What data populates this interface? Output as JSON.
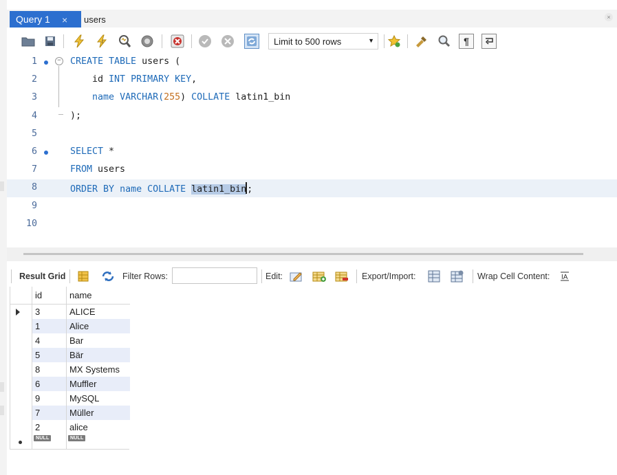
{
  "tabs": [
    {
      "label": "Query 1",
      "close": "×",
      "active": true
    },
    {
      "label": "users",
      "active": false
    }
  ],
  "toolbar": {
    "limit_label": "Limit to 500 rows",
    "icons": [
      "open-folder-icon",
      "save-icon",
      "execute-icon",
      "execute-current-icon",
      "explain-icon",
      "stop-icon",
      "toggle-error-icon",
      "commit-icon",
      "rollback-icon",
      "autocommit-icon",
      "bookmark-star-icon",
      "beautify-icon",
      "find-icon",
      "invisible-chars-icon",
      "wrap-icon"
    ]
  },
  "editor": {
    "lines": [
      {
        "n": "1",
        "tokens": [
          {
            "t": "CREATE TABLE ",
            "c": "kw"
          },
          {
            "t": "users (",
            "c": "id"
          }
        ]
      },
      {
        "n": "2",
        "tokens": [
          {
            "t": "    id ",
            "c": "id"
          },
          {
            "t": "INT PRIMARY KEY",
            "c": "kw"
          },
          {
            "t": ",",
            "c": "id"
          }
        ]
      },
      {
        "n": "3",
        "tokens": [
          {
            "t": "    name ",
            "c": "kw"
          },
          {
            "t": "VARCHAR(",
            "c": "kw"
          },
          {
            "t": "255",
            "c": "num-lit"
          },
          {
            "t": ") ",
            "c": "id"
          },
          {
            "t": "COLLATE ",
            "c": "kw"
          },
          {
            "t": "latin1_bin",
            "c": "id"
          }
        ]
      },
      {
        "n": "4",
        "tokens": [
          {
            "t": ");",
            "c": "id"
          }
        ]
      },
      {
        "n": "5",
        "tokens": []
      },
      {
        "n": "6",
        "tokens": [
          {
            "t": "SELECT ",
            "c": "kw"
          },
          {
            "t": "*",
            "c": "id"
          }
        ]
      },
      {
        "n": "7",
        "tokens": [
          {
            "t": "FROM ",
            "c": "kw"
          },
          {
            "t": "users",
            "c": "id"
          }
        ]
      },
      {
        "n": "8",
        "tokens": [
          {
            "t": "ORDER BY ",
            "c": "kw"
          },
          {
            "t": "name ",
            "c": "kw"
          },
          {
            "t": "COLLATE ",
            "c": "kw"
          },
          {
            "t": "latin1_bin",
            "c": "sel"
          },
          {
            "t": ";",
            "c": "id"
          }
        ]
      },
      {
        "n": "9",
        "tokens": []
      },
      {
        "n": "10",
        "tokens": []
      }
    ]
  },
  "results": {
    "result_grid_label": "Result Grid",
    "filter_label": "Filter Rows:",
    "filter_value": "",
    "edit_label": "Edit:",
    "export_label": "Export/Import:",
    "wrap_label": "Wrap Cell Content:",
    "columns": [
      "id",
      "name"
    ],
    "rows": [
      {
        "id": "3",
        "name": "ALICE"
      },
      {
        "id": "1",
        "name": "Alice"
      },
      {
        "id": "4",
        "name": "Bar"
      },
      {
        "id": "5",
        "name": "Bär"
      },
      {
        "id": "8",
        "name": "MX Systems"
      },
      {
        "id": "6",
        "name": "Muffler"
      },
      {
        "id": "9",
        "name": "MySQL"
      },
      {
        "id": "7",
        "name": "Müller"
      },
      {
        "id": "2",
        "name": "alice"
      }
    ],
    "null_badge": "NULL"
  }
}
